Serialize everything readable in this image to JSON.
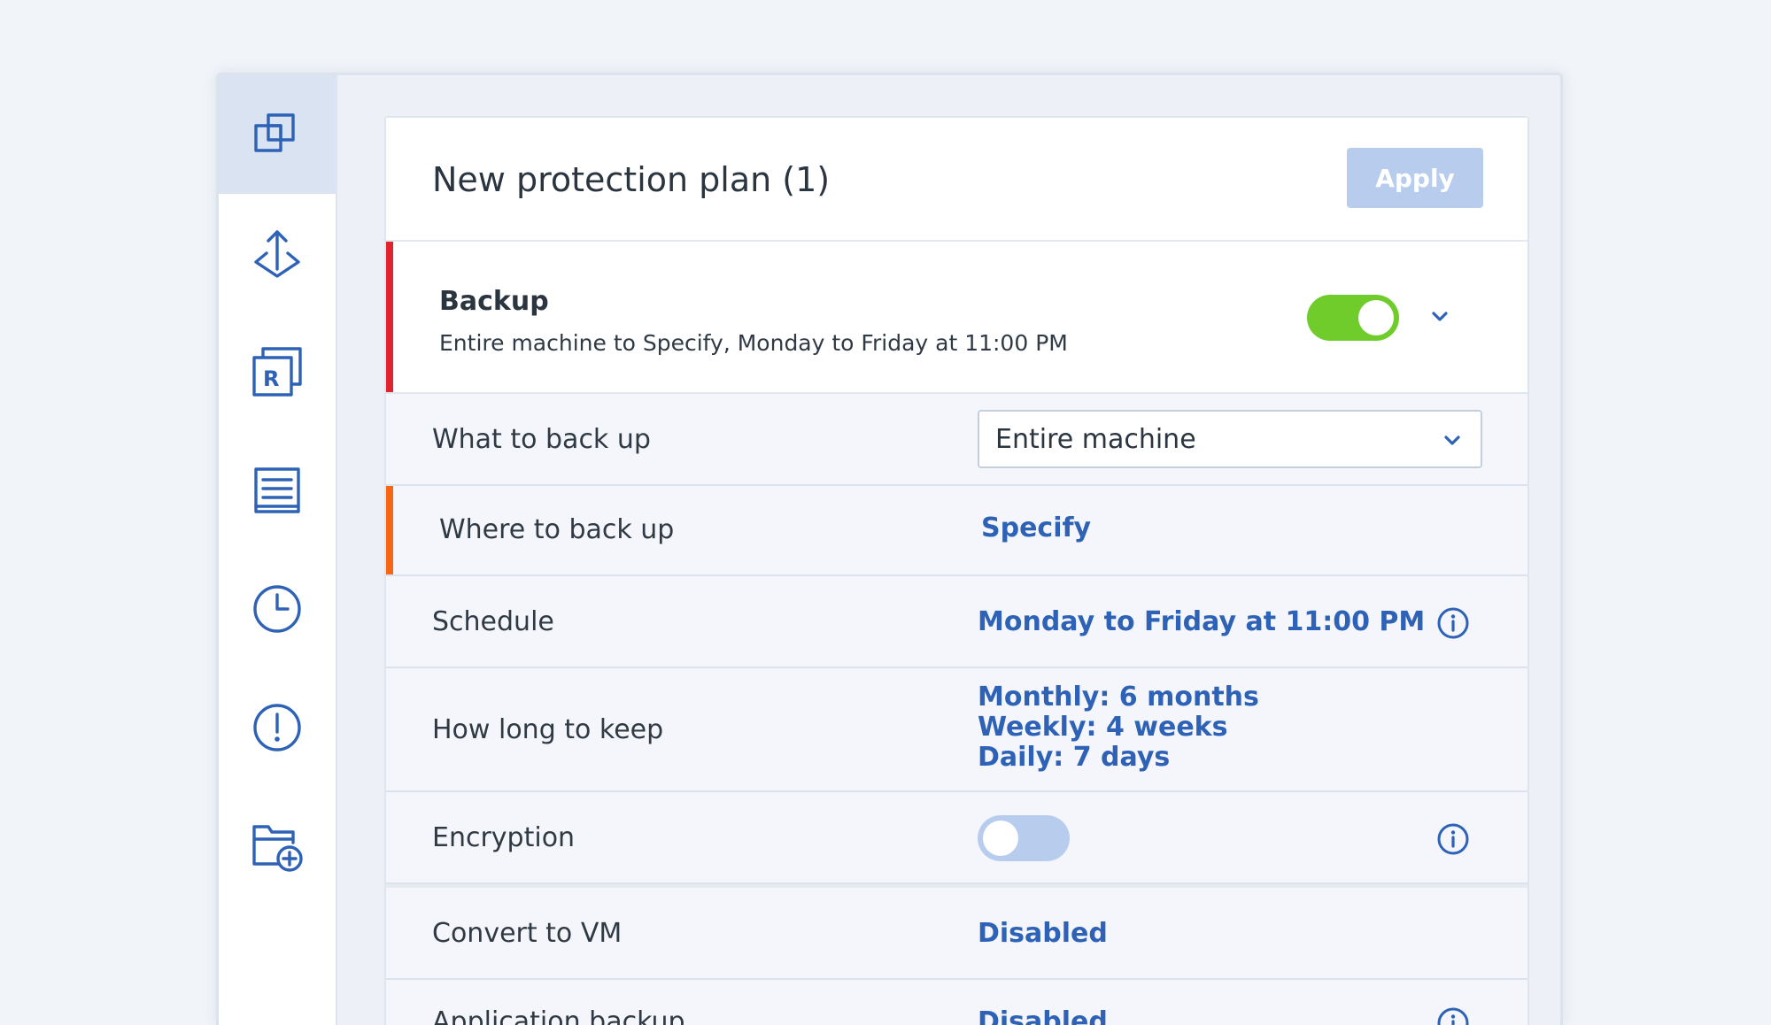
{
  "sidebar": {
    "items": [
      {
        "name": "plans-icon",
        "active": true
      },
      {
        "name": "recovery-icon",
        "active": false
      },
      {
        "name": "report-icon",
        "active": false
      },
      {
        "name": "activities-icon",
        "active": false
      },
      {
        "name": "history-icon",
        "active": false
      },
      {
        "name": "alerts-icon",
        "active": false
      },
      {
        "name": "add-folder-icon",
        "active": false
      }
    ]
  },
  "header": {
    "title": "New protection plan (1)",
    "apply_label": "Apply"
  },
  "module": {
    "title": "Backup",
    "subtitle": "Entire machine to Specify, Monday to Friday at 11:00 PM",
    "enabled": true
  },
  "rows": {
    "what": {
      "label": "What to back up",
      "value": "Entire machine"
    },
    "where": {
      "label": "Where to back up",
      "value": "Specify"
    },
    "schedule": {
      "label": "Schedule",
      "value": "Monday to Friday at 11:00 PM"
    },
    "retention": {
      "label": "How long to keep",
      "monthly": "Monthly: 6 months",
      "weekly": "Weekly: 4 weeks",
      "daily": "Daily: 7 days"
    },
    "encryption": {
      "label": "Encryption",
      "enabled": false
    },
    "convert": {
      "label": "Convert to VM",
      "value": "Disabled"
    },
    "app_backup": {
      "label": "Application backup",
      "value": "Disabled"
    }
  },
  "colors": {
    "accent": "#2d62b6",
    "toggle_on": "#6fcc2b",
    "toggle_off": "#b8cdee",
    "error_bar": "#e1232e",
    "warning_bar": "#f76612"
  }
}
